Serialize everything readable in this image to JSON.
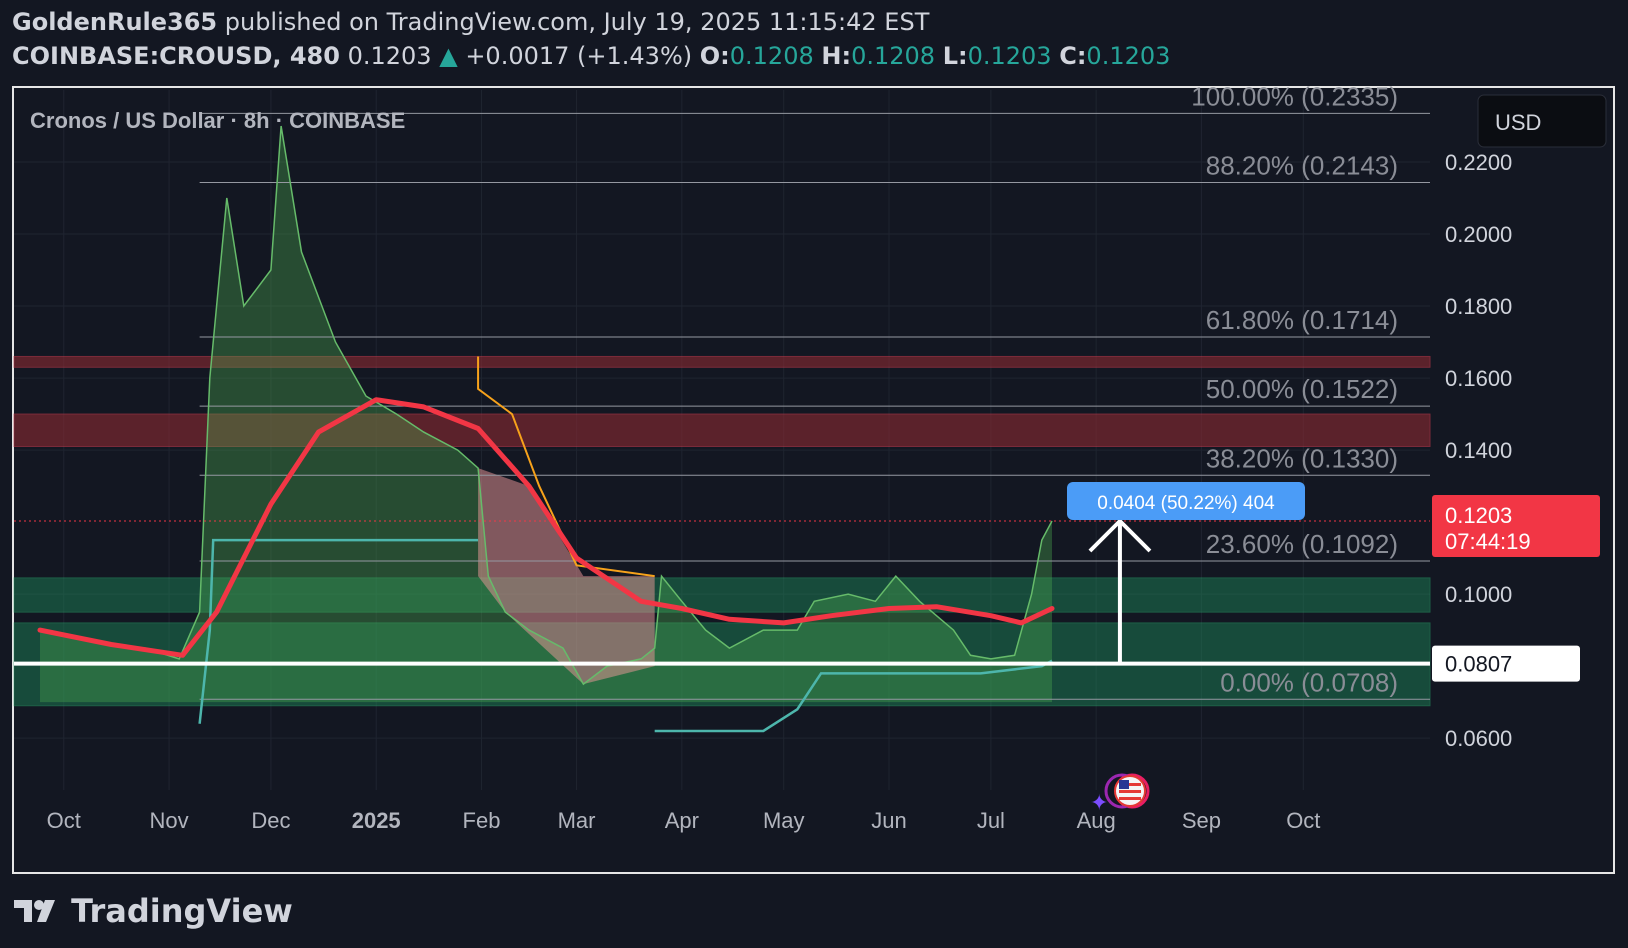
{
  "header": {
    "user": "GoldenRule365",
    "published": " published on TradingView.com, July 19, 2025 11:15:42 EST",
    "symbol": "COINBASE:CROUSD, 480",
    "last": "0.1203",
    "up_arrow": "▲",
    "change": "+0.0017 (+1.43%)",
    "o_label": "O:",
    "o_val": "0.1208",
    "h_label": "H:",
    "h_val": "0.1208",
    "l_label": "L:",
    "l_val": "0.1203",
    "c_label": "C:",
    "c_val": "0.1203"
  },
  "footer": {
    "brand": "TradingView"
  },
  "colors": {
    "bg": "#131722",
    "up": "#26a69a",
    "down": "#ef5350",
    "ma": "#f23645",
    "green_zone": "#1e8a5a",
    "red_zone": "#8b2a32",
    "fib_text": "#8a8d96",
    "orange": "#f7a21b",
    "measure": "#4b9cf7"
  },
  "chart_data": {
    "type": "line",
    "title": "Cronos / US Dollar · 8h · COINBASE",
    "currency": "USD",
    "x_labels": [
      "Oct",
      "Nov",
      "Dec",
      "2025",
      "Feb",
      "Mar",
      "Apr",
      "May",
      "Jun",
      "Jul",
      "Aug",
      "Sep",
      "Oct"
    ],
    "y_ticks": [
      "0.2200",
      "0.2000",
      "0.1800",
      "0.1600",
      "0.1400",
      "0.1000",
      "0.0600"
    ],
    "y_tick_values": [
      0.22,
      0.2,
      0.18,
      0.16,
      0.14,
      0.1,
      0.06
    ],
    "ylim": [
      0.0456,
      0.24
    ],
    "last_price": "0.1203",
    "last_price_value": 0.1203,
    "countdown": "07:44:19",
    "marked_price": "0.0807",
    "marked_price_value": 0.0807,
    "fib_levels": [
      {
        "label": "100.00% (0.2335)",
        "value": 0.2335
      },
      {
        "label": "88.20% (0.2143)",
        "value": 0.2143
      },
      {
        "label": "61.80% (0.1714)",
        "value": 0.1714
      },
      {
        "label": "50.00% (0.1522)",
        "value": 0.1522
      },
      {
        "label": "38.20% (0.1330)",
        "value": 0.133
      },
      {
        "label": "23.60% (0.1092)",
        "value": 0.1092
      },
      {
        "label": "0.00% (0.0708)",
        "value": 0.0708
      }
    ],
    "measure_label": "0.0404 (50.22%) 404",
    "resistance_zones": [
      [
        0.163,
        0.166
      ],
      [
        0.141,
        0.15
      ]
    ],
    "support_zones": [
      [
        0.095,
        0.1045
      ],
      [
        0.069,
        0.092
      ]
    ],
    "series": [
      {
        "name": "price",
        "dates": [
          "2024-09-24",
          "2024-10-05",
          "2024-10-15",
          "2024-10-25",
          "2024-11-04",
          "2024-11-10",
          "2024-11-13",
          "2024-11-18",
          "2024-11-23",
          "2024-12-01",
          "2024-12-04",
          "2024-12-10",
          "2024-12-20",
          "2024-12-29",
          "2025-01-07",
          "2025-01-15",
          "2025-01-25",
          "2025-01-31",
          "2025-02-03",
          "2025-02-08",
          "2025-02-15",
          "2025-02-25",
          "2025-03-03",
          "2025-03-10",
          "2025-03-20",
          "2025-03-24",
          "2025-03-26",
          "2025-04-01",
          "2025-04-08",
          "2025-04-15",
          "2025-04-25",
          "2025-05-05",
          "2025-05-10",
          "2025-05-20",
          "2025-05-28",
          "2025-06-03",
          "2025-06-10",
          "2025-06-20",
          "2025-06-25",
          "2025-07-01",
          "2025-07-08",
          "2025-07-13",
          "2025-07-16",
          "2025-07-19"
        ],
        "values": [
          0.09,
          0.088,
          0.086,
          0.085,
          0.082,
          0.095,
          0.16,
          0.21,
          0.18,
          0.19,
          0.23,
          0.195,
          0.17,
          0.155,
          0.15,
          0.145,
          0.14,
          0.135,
          0.105,
          0.095,
          0.09,
          0.085,
          0.075,
          0.08,
          0.082,
          0.085,
          0.105,
          0.098,
          0.09,
          0.085,
          0.09,
          0.09,
          0.098,
          0.1,
          0.098,
          0.105,
          0.098,
          0.09,
          0.083,
          0.082,
          0.083,
          0.1,
          0.115,
          0.1203
        ]
      },
      {
        "name": "ma",
        "dates": [
          "2024-09-24",
          "2024-10-15",
          "2024-11-05",
          "2024-11-15",
          "2024-12-01",
          "2024-12-15",
          "2025-01-01",
          "2025-01-15",
          "2025-01-31",
          "2025-02-15",
          "2025-03-01",
          "2025-03-20",
          "2025-04-01",
          "2025-04-15",
          "2025-05-01",
          "2025-05-15",
          "2025-06-01",
          "2025-06-15",
          "2025-07-01",
          "2025-07-10",
          "2025-07-19"
        ],
        "values": [
          0.09,
          0.086,
          0.083,
          0.095,
          0.125,
          0.145,
          0.154,
          0.152,
          0.146,
          0.13,
          0.11,
          0.098,
          0.096,
          0.093,
          0.092,
          0.094,
          0.096,
          0.0965,
          0.094,
          0.092,
          0.096
        ]
      }
    ]
  }
}
